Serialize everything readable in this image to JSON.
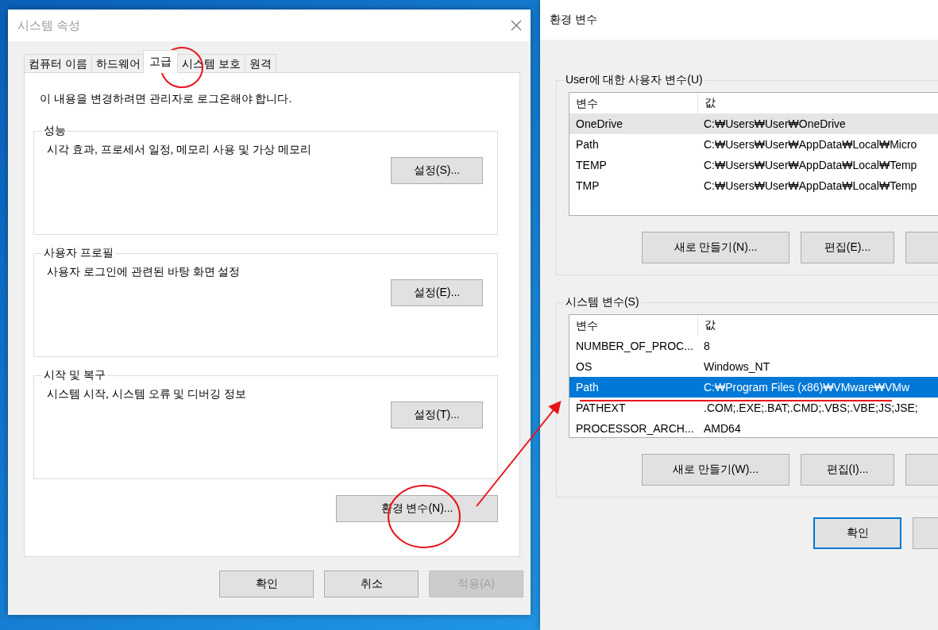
{
  "system_properties": {
    "title": "시스템 속성",
    "tabs": [
      {
        "label": "컴퓨터 이름",
        "selected": false
      },
      {
        "label": "하드웨어",
        "selected": false
      },
      {
        "label": "고급",
        "selected": true
      },
      {
        "label": "시스템 보호",
        "selected": false
      },
      {
        "label": "원격",
        "selected": false
      }
    ],
    "notice": "이 내용을 변경하려면 관리자로 로그온해야 합니다.",
    "groups": [
      {
        "title": "성능",
        "description": "시각 효과, 프로세서 일정, 메모리 사용 및 가상 메모리",
        "button": "설정(S)..."
      },
      {
        "title": "사용자 프로필",
        "description": "사용자 로그인에 관련된 바탕 화면 설정",
        "button": "설정(E)..."
      },
      {
        "title": "시작 및 복구",
        "description": "시스템 시작, 시스템 오류 및 디버깅 정보",
        "button": "설정(T)..."
      }
    ],
    "env_button": "환경 변수(N)...",
    "buttons": [
      {
        "label": "확인",
        "disabled": false
      },
      {
        "label": "취소",
        "disabled": false
      },
      {
        "label": "적용(A)",
        "disabled": true
      }
    ]
  },
  "env_vars": {
    "title": "환경 변수",
    "lists": [
      {
        "title": "User에 대한 사용자 변수(U)",
        "focused": false,
        "columns": [
          "변수",
          "값"
        ],
        "rows": [
          {
            "name": "OneDrive",
            "value": "C:₩Users₩User₩OneDrive",
            "selected": true
          },
          {
            "name": "Path",
            "value": "C:₩Users₩User₩AppData₩Local₩Micro",
            "selected": false
          },
          {
            "name": "TEMP",
            "value": "C:₩Users₩User₩AppData₩Local₩Temp",
            "selected": false
          },
          {
            "name": "TMP",
            "value": "C:₩Users₩User₩AppData₩Local₩Temp",
            "selected": false
          }
        ],
        "buttons": [
          "새로 만들기(N)...",
          "편집(E)..."
        ]
      },
      {
        "title": "시스템 변수(S)",
        "focused": true,
        "columns": [
          "변수",
          "값"
        ],
        "rows": [
          {
            "name": "NUMBER_OF_PROC...",
            "value": "8",
            "selected": false
          },
          {
            "name": "OS",
            "value": "Windows_NT",
            "selected": false
          },
          {
            "name": "Path",
            "value": "C:₩Program Files (x86)₩VMware₩VMw",
            "selected": true
          },
          {
            "name": "PATHEXT",
            "value": ".COM;.EXE;.BAT;.CMD;.VBS;.VBE;JS;JSE;",
            "selected": false
          },
          {
            "name": "PROCESSOR_ARCH...",
            "value": "AMD64",
            "selected": false
          }
        ],
        "buttons": [
          "새로 만들기(W)...",
          "편집(I)..."
        ]
      }
    ],
    "ok_button": "확인"
  }
}
